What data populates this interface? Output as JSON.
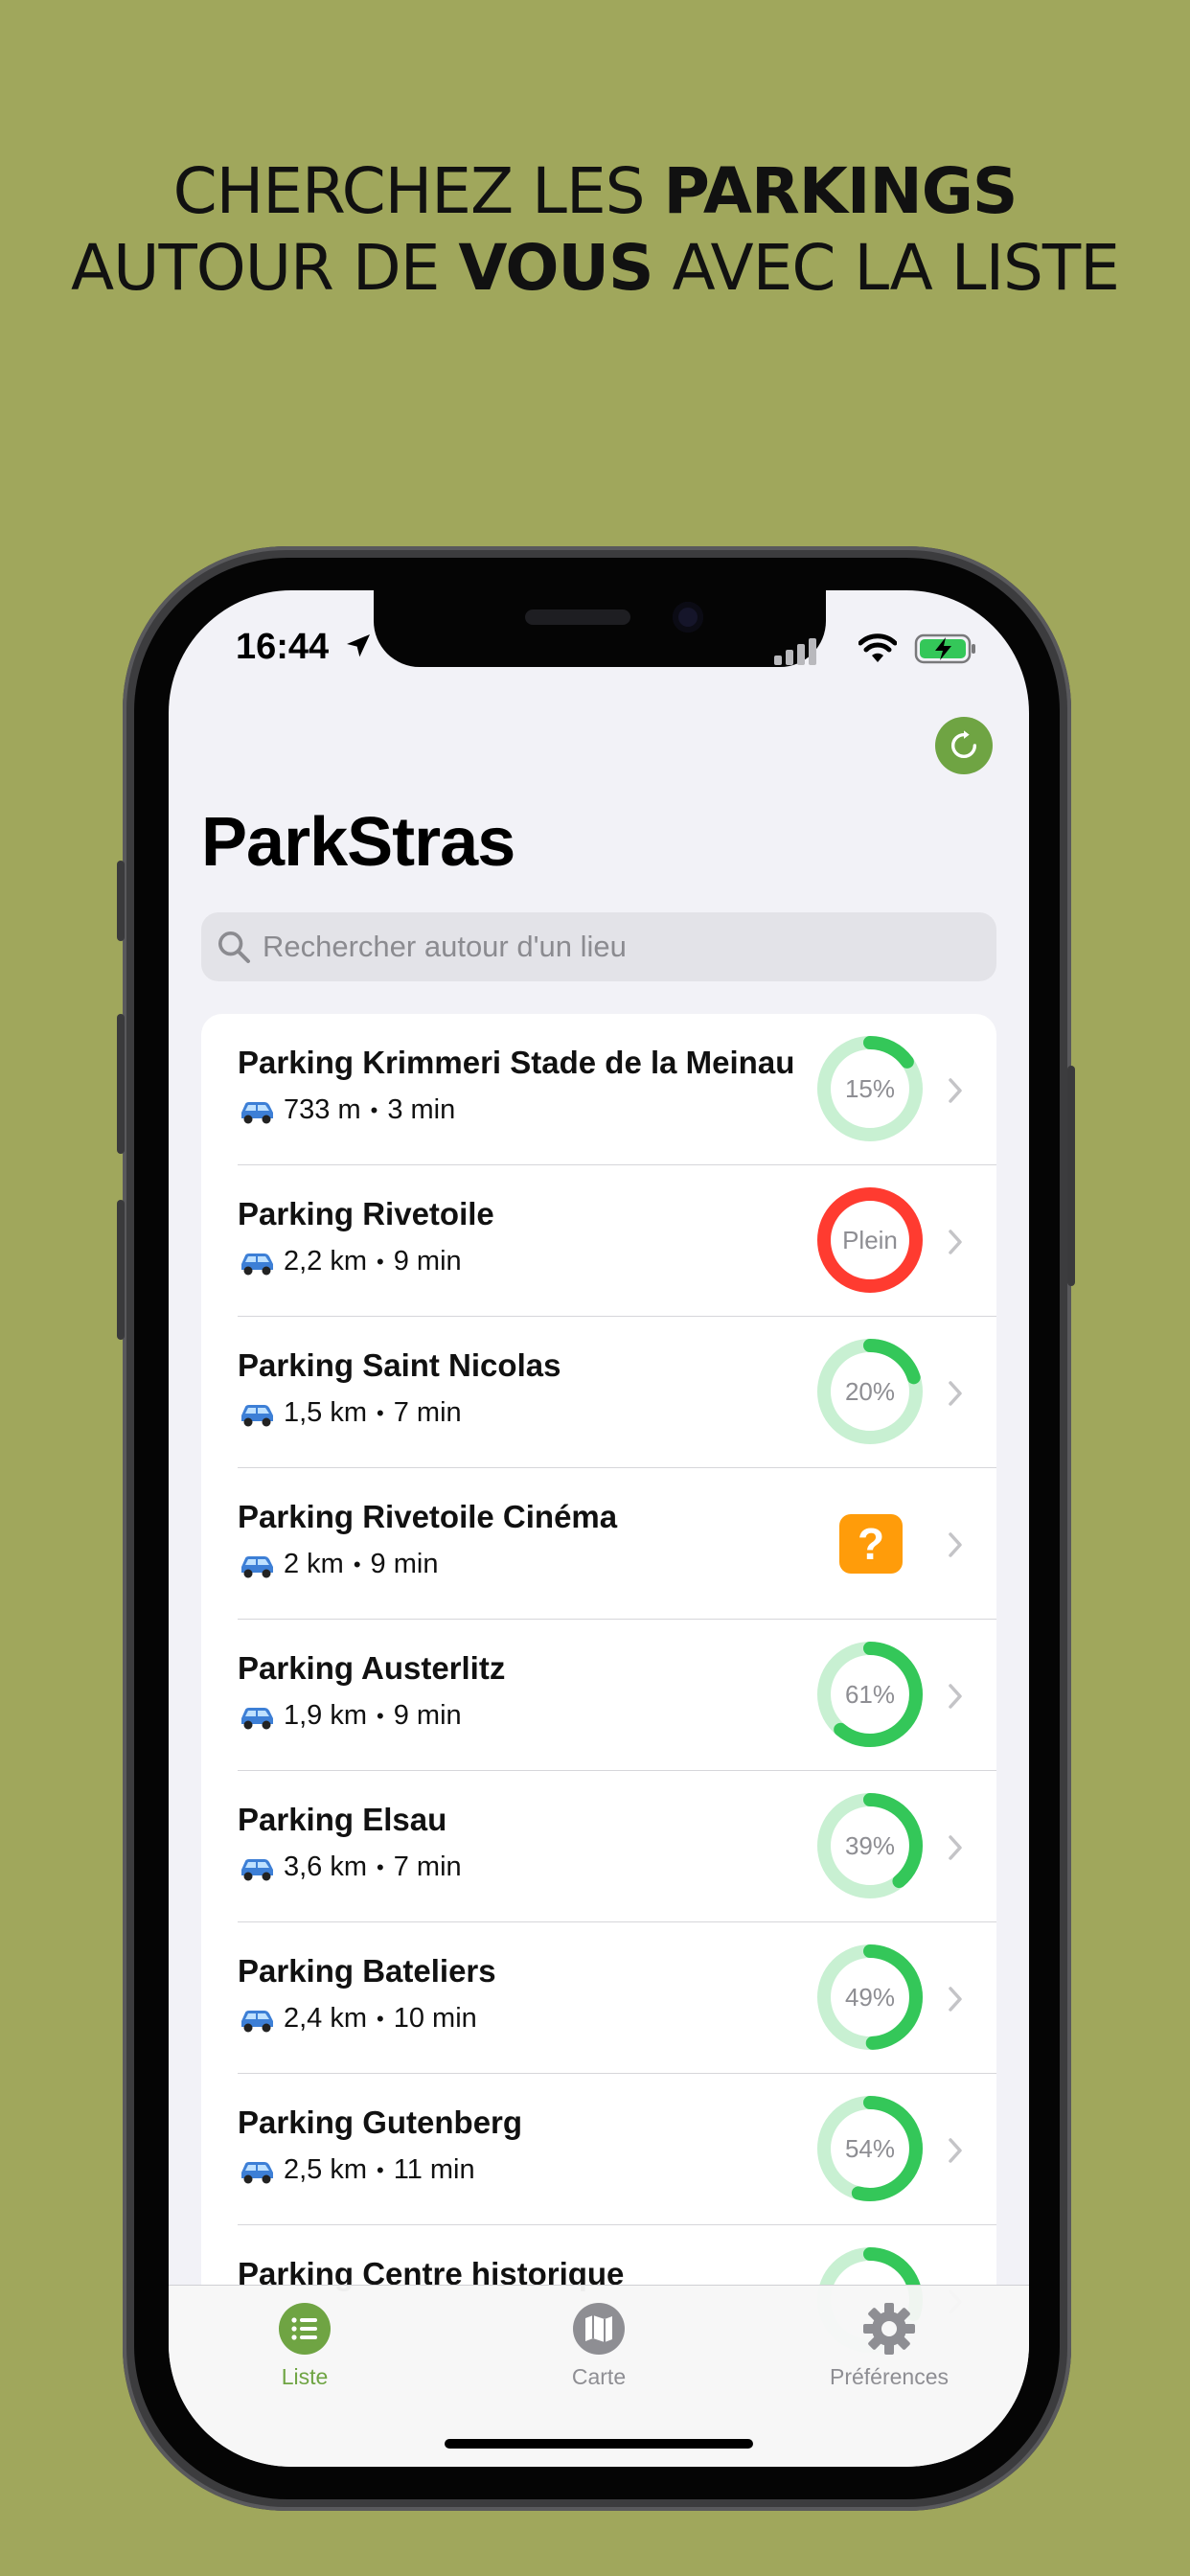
{
  "headline": {
    "line1_pre": "CHERCHEZ LES ",
    "line1_bold": "PARKINGS",
    "line2_pre": "AUTOUR DE ",
    "line2_bold": "VOUS",
    "line2_post": " AVEC LA LISTE"
  },
  "status_bar": {
    "time": "16:44"
  },
  "app": {
    "title": "ParkStras",
    "search_placeholder": "Rechercher autour d'un lieu"
  },
  "colors": {
    "accent": "#6fa443",
    "gauge_green": "#34c759",
    "gauge_track": "#c8f0d2",
    "full_red": "#ff3b30",
    "unknown_orange": "#ff9c0a",
    "background": "#a0a75c"
  },
  "parkings": [
    {
      "name": "Parking Krimmeri Stade de la Meinau",
      "distance": "733 m",
      "duration": "3 min",
      "status": "percent",
      "label": "15%",
      "value": 0.15
    },
    {
      "name": "Parking Rivetoile",
      "distance": "2,2 km",
      "duration": "9 min",
      "status": "full",
      "label": "Plein",
      "value": 1.0
    },
    {
      "name": "Parking Saint Nicolas",
      "distance": "1,5 km",
      "duration": "7 min",
      "status": "percent",
      "label": "20%",
      "value": 0.2
    },
    {
      "name": "Parking Rivetoile Cinéma",
      "distance": "2 km",
      "duration": "9 min",
      "status": "unknown",
      "label": "?",
      "value": null
    },
    {
      "name": "Parking Austerlitz",
      "distance": "1,9 km",
      "duration": "9 min",
      "status": "percent",
      "label": "61%",
      "value": 0.61
    },
    {
      "name": "Parking Elsau",
      "distance": "3,6 km",
      "duration": "7 min",
      "status": "percent",
      "label": "39%",
      "value": 0.39
    },
    {
      "name": "Parking Bateliers",
      "distance": "2,4 km",
      "duration": "10 min",
      "status": "percent",
      "label": "49%",
      "value": 0.49
    },
    {
      "name": "Parking Gutenberg",
      "distance": "2,5 km",
      "duration": "11 min",
      "status": "percent",
      "label": "54%",
      "value": 0.54
    },
    {
      "name": "Parking Centre historique",
      "distance": "",
      "duration": "",
      "status": "percent",
      "label": "",
      "value": 0.3
    }
  ],
  "tabs": [
    {
      "label": "Liste",
      "icon": "list-icon",
      "active": true
    },
    {
      "label": "Carte",
      "icon": "map-icon",
      "active": false
    },
    {
      "label": "Préférences",
      "icon": "gear-icon",
      "active": false
    }
  ]
}
